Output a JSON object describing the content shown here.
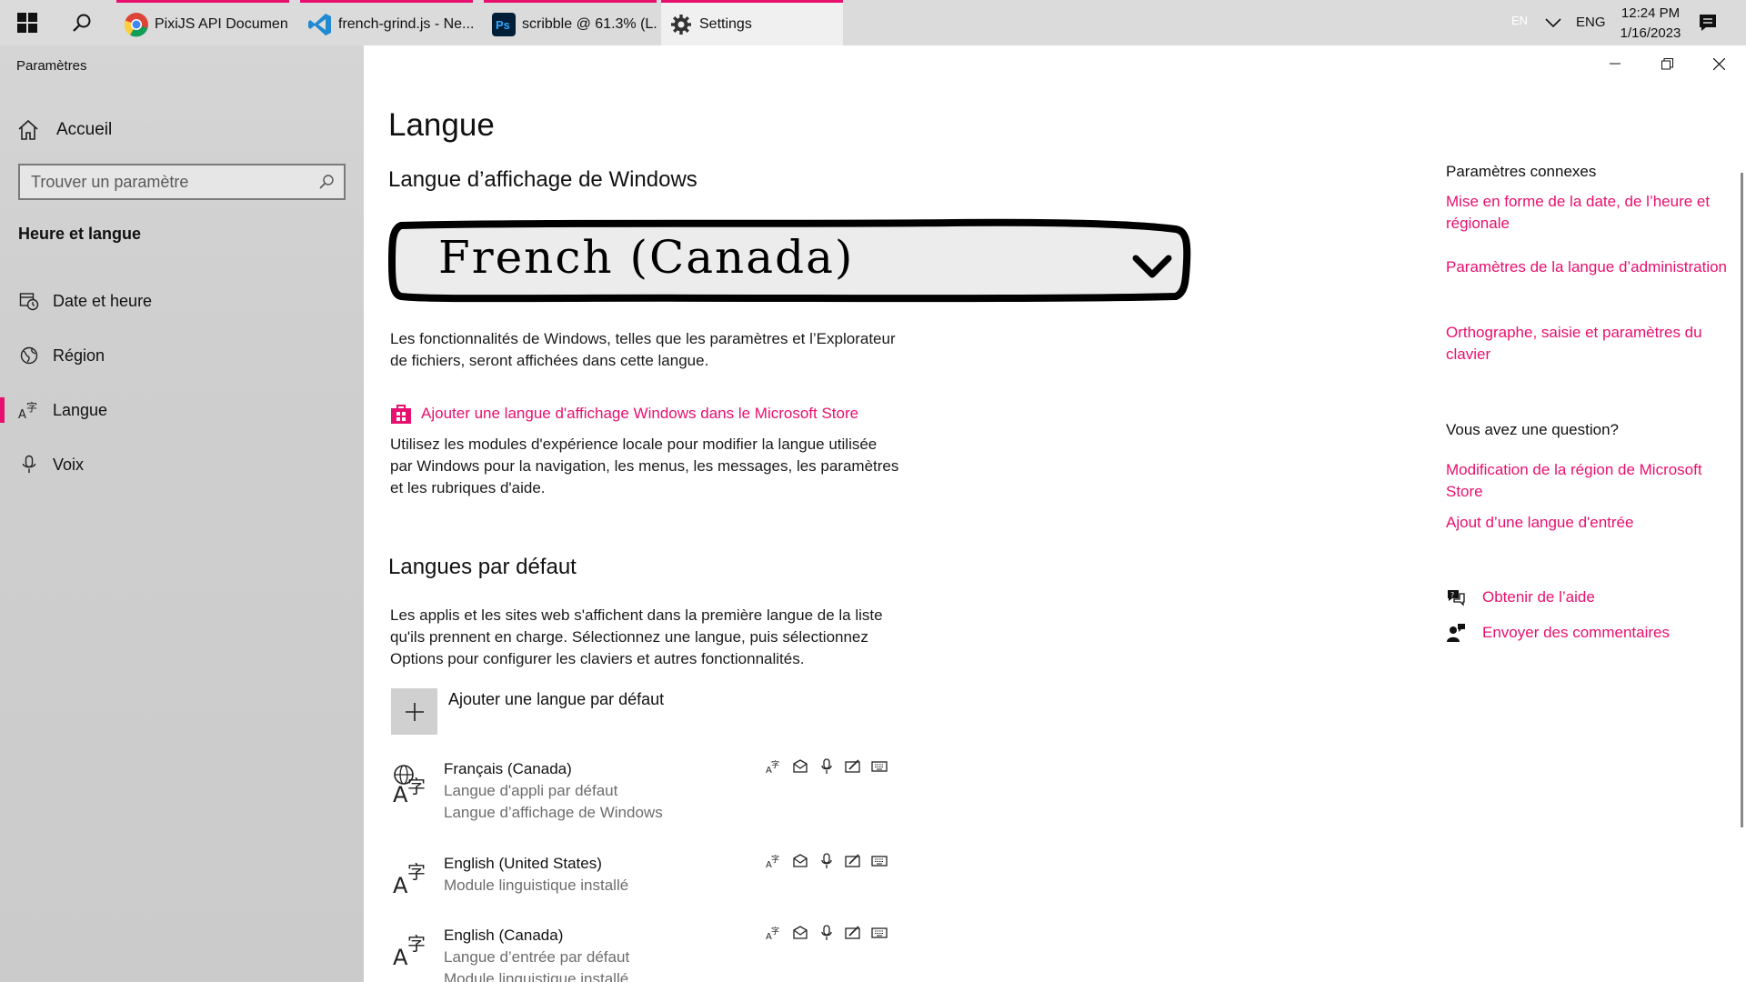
{
  "taskbar": {
    "tabs": [
      {
        "label": "PixiJS API Documen...",
        "icon": "chrome-icon"
      },
      {
        "label": "french-grind.js - Ne...",
        "icon": "vscode-icon"
      },
      {
        "label": "scribble @ 61.3% (L...",
        "icon": "photoshop-icon"
      },
      {
        "label": "Settings",
        "icon": "gear-icon"
      }
    ],
    "ps_badge": "Ps",
    "tray": {
      "input_indicator": "EN",
      "language": "ENG",
      "time": "12:24 PM",
      "date": "1/16/2023"
    },
    "accent_color": "#e8106e"
  },
  "nav": {
    "app_title": "Paramètres",
    "home_label": "Accueil",
    "search_placeholder": "Trouver un paramètre",
    "section_title": "Heure et langue",
    "items": [
      {
        "label": "Date et heure",
        "icon": "calendar-clock-icon"
      },
      {
        "label": "Région",
        "icon": "globe-icon"
      },
      {
        "label": "Langue",
        "icon": "language-icon",
        "selected": true
      },
      {
        "label": "Voix",
        "icon": "microphone-icon"
      }
    ]
  },
  "main": {
    "page_title": "Langue",
    "display_section": {
      "title": "Langue d’affichage de Windows",
      "dropdown_value": "French (Canada)",
      "description": "Les fonctionnalités de Windows, telles que les paramètres et l’Explorateur de fichiers, seront affichées dans cette langue.",
      "store_link": "Ajouter une langue d'affichage Windows dans le Microsoft Store",
      "store_description": "Utilisez les modules d'expérience locale pour modifier la langue utilisée par Windows pour la navigation, les menus, les messages, les paramètres et les rubriques d'aide."
    },
    "default_section": {
      "title": "Langues par défaut",
      "description": "Les applis et les sites web s'affichent dans la première langue de la liste qu'ils prennent en charge. Sélectionnez une langue, puis sélectionnez Options pour configurer les claviers et autres fonctionnalités.",
      "add_label": "Ajouter une langue par défaut",
      "languages": [
        {
          "name": "Français (Canada)",
          "sub1": "Langue d'appli par défaut",
          "sub2": "Langue d’affichage de Windows",
          "icon": "globe-language-icon"
        },
        {
          "name": "English (United States)",
          "sub1": "Module linguistique installé",
          "sub2": "",
          "icon": "language-icon"
        },
        {
          "name": "English (Canada)",
          "sub1": "Langue d’entrée par défaut",
          "sub2": "Module linguistique installé",
          "icon": "language-icon"
        }
      ],
      "feature_icons": [
        "language-pack-icon",
        "speech-icon",
        "microphone-icon",
        "handwriting-icon",
        "keyboard-icon"
      ]
    }
  },
  "related": {
    "heading": "Paramètres connexes",
    "links": [
      "Mise en forme de la date, de l’heure et régionale",
      "Paramètres de la langue d’administration",
      "Orthographe, saisie et paramètres du clavier"
    ],
    "question_heading": "Vous avez une question?",
    "question_links": [
      "Modification de la région de Microsoft Store",
      "Ajout d’une langue d'entrée"
    ],
    "help_label": "Obtenir de l’aide",
    "feedback_label": "Envoyer des commentaires"
  }
}
